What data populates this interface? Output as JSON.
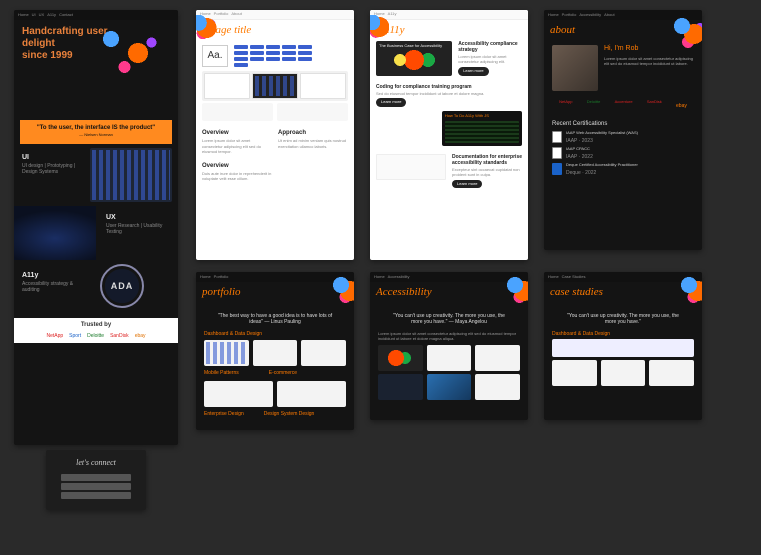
{
  "nav": {
    "items": [
      "Home",
      "UI",
      "UX",
      "A11y",
      "Portfolio",
      "Case Studies",
      "Accessibility",
      "About",
      "Contact"
    ]
  },
  "home": {
    "heroLine1": "Handcrafting user delight",
    "heroLine2": "since 1999",
    "quote": "\"To the user, the interface IS the product\"",
    "quoteAttr": "— Nielsen Norman",
    "tiles": {
      "ui": {
        "title": "UI",
        "sub": "UI design | Prototyping | Design Systems"
      },
      "ux": {
        "title": "UX",
        "sub": "User Research | Usability Testing"
      },
      "a11y": {
        "title": "A11y",
        "sub": "Accessibility strategy & auditing"
      }
    },
    "trustedTitle": "Trusted by",
    "trustedLogos": [
      "NetApp",
      "Sport",
      "Deloitte",
      "SanDisk",
      "ebay"
    ],
    "connect": {
      "title": "let's connect"
    },
    "ada": "ADA"
  },
  "pageTitle": {
    "title": "page title",
    "aa": "Aa.",
    "sections": {
      "overview1": "Overview",
      "approach": "Approach",
      "overview2": "Overview"
    }
  },
  "a11y": {
    "title": "a11y",
    "card1": "The Business Case for Accessibility",
    "h1": "Accessibility compliance strategy",
    "h2": "Coding for compliance training program",
    "h3": "Documentation for enterprise accessibility standards",
    "codeCardTitle": "How To Do A11y With JS",
    "btn": "Learn more"
  },
  "about": {
    "title": "about",
    "greeting": "Hi, I'm Rob",
    "logos": [
      "NetApp",
      "Deloitte",
      "Accenture",
      "SanDisk",
      "ebay"
    ],
    "certTitle": "Recent Certifications",
    "certs": [
      "IAAP Web Accessibility Specialist (WAS)",
      "IAAP CPACC",
      "Deque Certified Accessibility Practitioner"
    ]
  },
  "portfolio": {
    "title": "portfolio",
    "quote": "\"The best way to have a good idea is to have lots of ideas\" — Linus Pauling",
    "groups": [
      "Dashboard & Data Design",
      "Mobile Patterns",
      "E-commerce",
      "Enterprise Design",
      "Design System Design"
    ]
  },
  "accessibility": {
    "title": "Accessibility",
    "quote": "\"You can't use up creativity. The more you use, the more you have.\" — Maya Angelou"
  },
  "caseStudies": {
    "title": "case studies",
    "quote": "\"You can't use up creativity. The more you use, the more you have.\""
  }
}
